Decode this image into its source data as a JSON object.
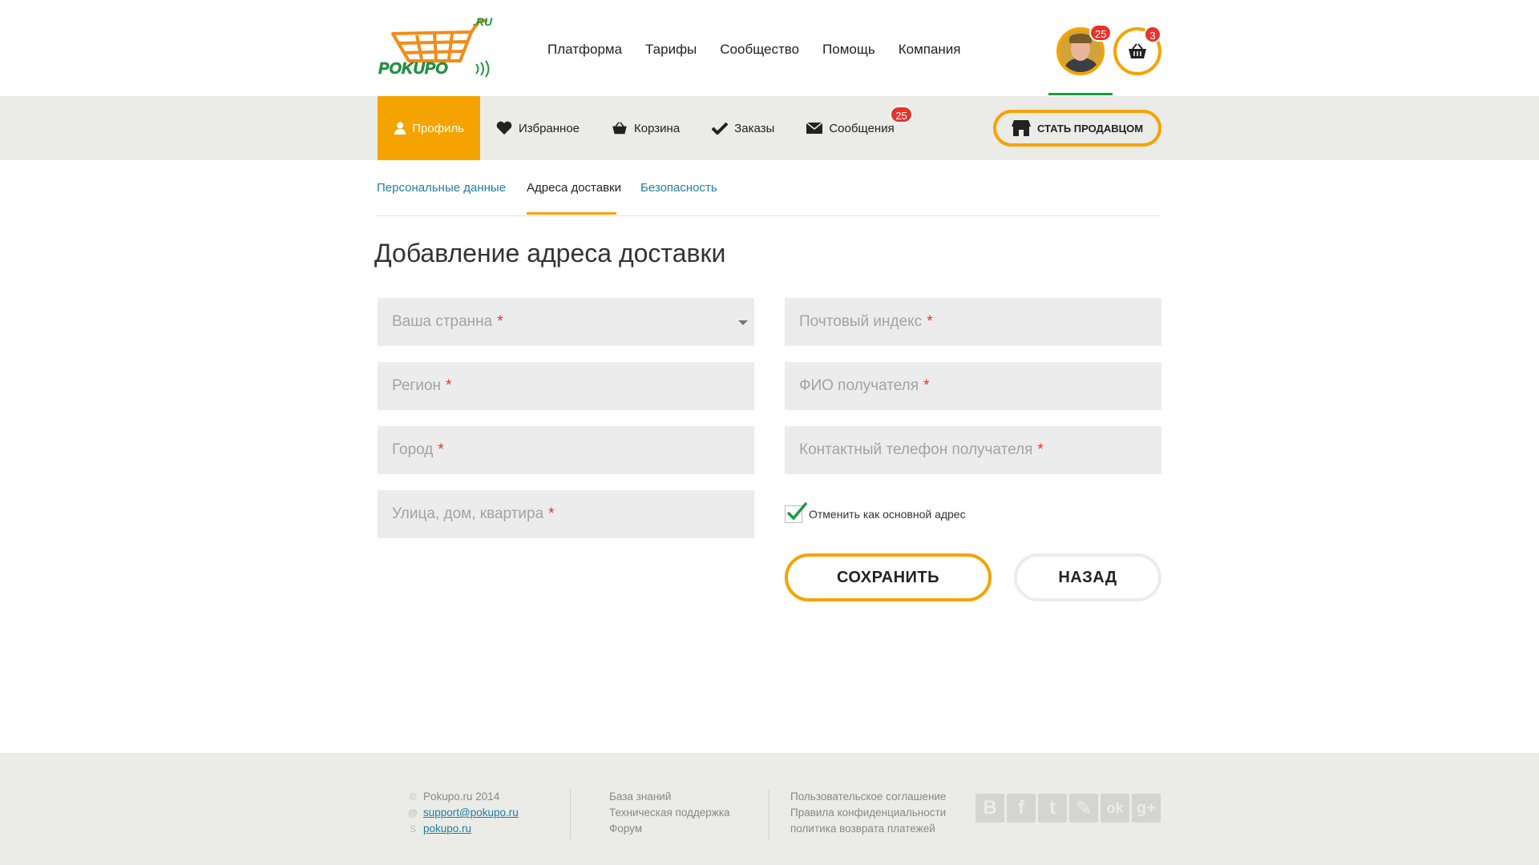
{
  "header": {
    "logo_text": "POKUPO",
    "logo_suffix": ".RU",
    "nav": [
      "Платформа",
      "Тарифы",
      "Сообщество",
      "Помощь",
      "Компания"
    ],
    "avatar_badge": "25",
    "cart_badge": "3"
  },
  "subnav": {
    "items": [
      {
        "label": "Профиль",
        "icon": "user-icon"
      },
      {
        "label": "Избранное",
        "icon": "heart-icon"
      },
      {
        "label": "Корзина",
        "icon": "basket-icon"
      },
      {
        "label": "Заказы",
        "icon": "check-icon"
      },
      {
        "label": "Сообщения",
        "icon": "envelope-icon"
      }
    ],
    "messages_badge": "25",
    "seller_button": "СТАТЬ ПРОДАВЦОМ"
  },
  "tabs": [
    "Персональные данные",
    "Адреса доставки",
    "Безопасность"
  ],
  "page_title": "Добавление адреса доставки",
  "form": {
    "country_placeholder": "Ваша странна",
    "region_placeholder": "Регион",
    "city_placeholder": "Город",
    "street_placeholder": "Улица, дом, квартира",
    "postal_placeholder": "Почтовый индекс",
    "recipient_placeholder": "ФИО получателя",
    "phone_placeholder": "Контактный телефон получателя",
    "required_mark": "*",
    "checkbox_label": "Отменить как основной адрес",
    "checkbox_checked": true,
    "save_label": "СОХРАНИТЬ",
    "back_label": "НАЗАД"
  },
  "footer": {
    "copyright": "Pokupo.ru 2014",
    "email": "support@pokupo.ru",
    "skype": "pokupo.ru",
    "col2": [
      "База знаний",
      "Техническая поддержка",
      "Форум"
    ],
    "col3": [
      "Пользовательское соглашение",
      "Правила конфиденциальности",
      "политика возврата платежей"
    ],
    "social": [
      "В",
      "f",
      "t",
      "✎",
      "ok",
      "g+"
    ]
  },
  "colors": {
    "accent": "#f5a300",
    "link": "#1e7fa0",
    "badge": "#e8322b",
    "green": "#1a9a3e"
  }
}
